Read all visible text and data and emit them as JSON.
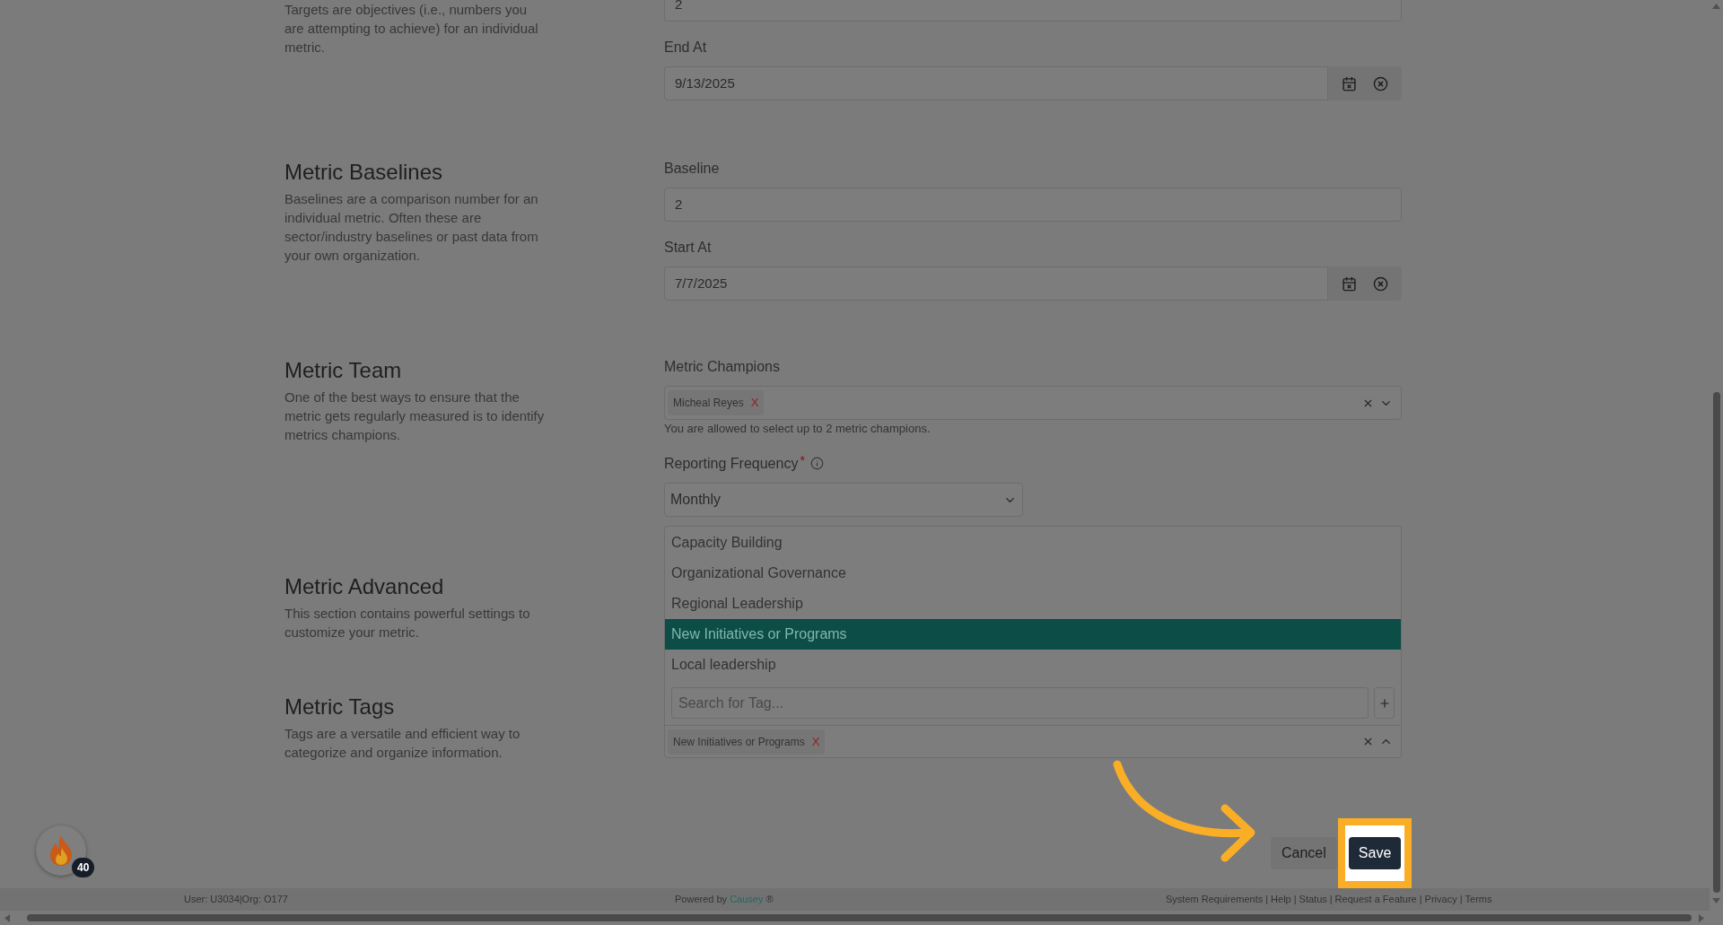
{
  "sections": [
    {
      "description": "Targets are objectives (i.e., numbers you are attempting to achieve) for an individual metric.",
      "fields": [
        {
          "kind": "text",
          "value": "2"
        },
        {
          "kind": "date",
          "label": "End At",
          "value": "9/13/2025"
        }
      ]
    },
    {
      "title": "Metric Baselines",
      "description": "Baselines are a comparison number for an individual metric. Often these are sector/industry baselines or past data from your own organization.",
      "fields": [
        {
          "kind": "text",
          "label": "Baseline",
          "value": "2"
        },
        {
          "kind": "date",
          "label": "Start At",
          "value": "7/7/2025"
        }
      ]
    },
    {
      "title": "Metric Team",
      "description": "One of the best ways to ensure that the metric gets regularly measured is to identify metrics champions.",
      "fields": [
        {
          "kind": "multiselect",
          "label": "Metric Champions",
          "chips": [
            {
              "label": "Micheal Reyes",
              "remove": "X"
            }
          ],
          "help": "You are allowed to select up to 2 metric champions."
        },
        {
          "kind": "select",
          "label": "Reporting Frequency",
          "required_mark": "*",
          "value": "Monthly"
        }
      ]
    },
    {
      "title": "Metric Advanced",
      "description": "This section contains powerful settings to customize your metric."
    },
    {
      "title": "Metric Tags",
      "description": "Tags are a versatile and efficient way to categorize and organize information.",
      "fields": [
        {
          "kind": "tags",
          "expanded": true,
          "options": [
            {
              "label": "Capacity Building",
              "selected": false
            },
            {
              "label": "Organizational Governance",
              "selected": false
            },
            {
              "label": "Regional Leadership",
              "selected": false
            },
            {
              "label": "New Initiatives or Programs",
              "selected": true
            },
            {
              "label": "Local leadership",
              "selected": false
            }
          ],
          "search_placeholder": "Search for Tag...",
          "chips": [
            {
              "label": "New Initiatives or Programs",
              "remove": "X"
            }
          ]
        }
      ]
    }
  ],
  "actions": [
    {
      "label": "Cancel",
      "kind": "secondary",
      "highlighted": false
    },
    {
      "label": "Save",
      "kind": "primary",
      "highlighted": true
    }
  ],
  "badge": {
    "count": "40"
  },
  "footer": {
    "user": "User: U3034|Org: O177",
    "powered_by": "Powered by",
    "brand": "Causey",
    "brand_mark": "®",
    "separator": "|",
    "links": [
      "System Requirements",
      "Help",
      "Status",
      "Request a Feature",
      "Privacy",
      "Terms"
    ]
  }
}
